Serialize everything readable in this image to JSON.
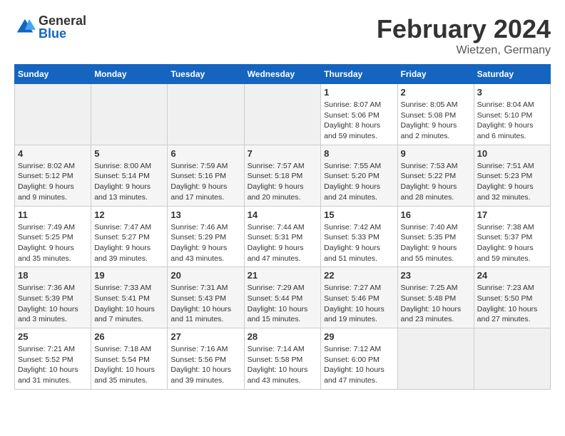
{
  "header": {
    "logo_general": "General",
    "logo_blue": "Blue",
    "title": "February 2024",
    "location": "Wietzen, Germany"
  },
  "days_of_week": [
    "Sunday",
    "Monday",
    "Tuesday",
    "Wednesday",
    "Thursday",
    "Friday",
    "Saturday"
  ],
  "weeks": [
    [
      {
        "day": "",
        "detail": ""
      },
      {
        "day": "",
        "detail": ""
      },
      {
        "day": "",
        "detail": ""
      },
      {
        "day": "",
        "detail": ""
      },
      {
        "day": "1",
        "detail": "Sunrise: 8:07 AM\nSunset: 5:06 PM\nDaylight: 8 hours and 59 minutes."
      },
      {
        "day": "2",
        "detail": "Sunrise: 8:05 AM\nSunset: 5:08 PM\nDaylight: 9 hours and 2 minutes."
      },
      {
        "day": "3",
        "detail": "Sunrise: 8:04 AM\nSunset: 5:10 PM\nDaylight: 9 hours and 6 minutes."
      }
    ],
    [
      {
        "day": "4",
        "detail": "Sunrise: 8:02 AM\nSunset: 5:12 PM\nDaylight: 9 hours and 9 minutes."
      },
      {
        "day": "5",
        "detail": "Sunrise: 8:00 AM\nSunset: 5:14 PM\nDaylight: 9 hours and 13 minutes."
      },
      {
        "day": "6",
        "detail": "Sunrise: 7:59 AM\nSunset: 5:16 PM\nDaylight: 9 hours and 17 minutes."
      },
      {
        "day": "7",
        "detail": "Sunrise: 7:57 AM\nSunset: 5:18 PM\nDaylight: 9 hours and 20 minutes."
      },
      {
        "day": "8",
        "detail": "Sunrise: 7:55 AM\nSunset: 5:20 PM\nDaylight: 9 hours and 24 minutes."
      },
      {
        "day": "9",
        "detail": "Sunrise: 7:53 AM\nSunset: 5:22 PM\nDaylight: 9 hours and 28 minutes."
      },
      {
        "day": "10",
        "detail": "Sunrise: 7:51 AM\nSunset: 5:23 PM\nDaylight: 9 hours and 32 minutes."
      }
    ],
    [
      {
        "day": "11",
        "detail": "Sunrise: 7:49 AM\nSunset: 5:25 PM\nDaylight: 9 hours and 35 minutes."
      },
      {
        "day": "12",
        "detail": "Sunrise: 7:47 AM\nSunset: 5:27 PM\nDaylight: 9 hours and 39 minutes."
      },
      {
        "day": "13",
        "detail": "Sunrise: 7:46 AM\nSunset: 5:29 PM\nDaylight: 9 hours and 43 minutes."
      },
      {
        "day": "14",
        "detail": "Sunrise: 7:44 AM\nSunset: 5:31 PM\nDaylight: 9 hours and 47 minutes."
      },
      {
        "day": "15",
        "detail": "Sunrise: 7:42 AM\nSunset: 5:33 PM\nDaylight: 9 hours and 51 minutes."
      },
      {
        "day": "16",
        "detail": "Sunrise: 7:40 AM\nSunset: 5:35 PM\nDaylight: 9 hours and 55 minutes."
      },
      {
        "day": "17",
        "detail": "Sunrise: 7:38 AM\nSunset: 5:37 PM\nDaylight: 9 hours and 59 minutes."
      }
    ],
    [
      {
        "day": "18",
        "detail": "Sunrise: 7:36 AM\nSunset: 5:39 PM\nDaylight: 10 hours and 3 minutes."
      },
      {
        "day": "19",
        "detail": "Sunrise: 7:33 AM\nSunset: 5:41 PM\nDaylight: 10 hours and 7 minutes."
      },
      {
        "day": "20",
        "detail": "Sunrise: 7:31 AM\nSunset: 5:43 PM\nDaylight: 10 hours and 11 minutes."
      },
      {
        "day": "21",
        "detail": "Sunrise: 7:29 AM\nSunset: 5:44 PM\nDaylight: 10 hours and 15 minutes."
      },
      {
        "day": "22",
        "detail": "Sunrise: 7:27 AM\nSunset: 5:46 PM\nDaylight: 10 hours and 19 minutes."
      },
      {
        "day": "23",
        "detail": "Sunrise: 7:25 AM\nSunset: 5:48 PM\nDaylight: 10 hours and 23 minutes."
      },
      {
        "day": "24",
        "detail": "Sunrise: 7:23 AM\nSunset: 5:50 PM\nDaylight: 10 hours and 27 minutes."
      }
    ],
    [
      {
        "day": "25",
        "detail": "Sunrise: 7:21 AM\nSunset: 5:52 PM\nDaylight: 10 hours and 31 minutes."
      },
      {
        "day": "26",
        "detail": "Sunrise: 7:18 AM\nSunset: 5:54 PM\nDaylight: 10 hours and 35 minutes."
      },
      {
        "day": "27",
        "detail": "Sunrise: 7:16 AM\nSunset: 5:56 PM\nDaylight: 10 hours and 39 minutes."
      },
      {
        "day": "28",
        "detail": "Sunrise: 7:14 AM\nSunset: 5:58 PM\nDaylight: 10 hours and 43 minutes."
      },
      {
        "day": "29",
        "detail": "Sunrise: 7:12 AM\nSunset: 6:00 PM\nDaylight: 10 hours and 47 minutes."
      },
      {
        "day": "",
        "detail": ""
      },
      {
        "day": "",
        "detail": ""
      }
    ]
  ]
}
